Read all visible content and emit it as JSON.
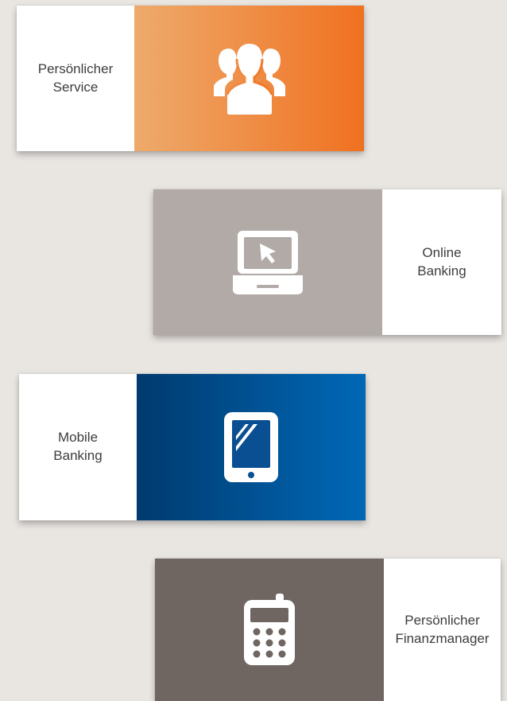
{
  "tiles": [
    {
      "id": "persoenlicher-service",
      "label_line1": "Persönlicher",
      "label_line2": "Service",
      "icon": "users-group-icon",
      "gradient_from": "#eeaa6c",
      "gradient_to": "#f07120"
    },
    {
      "id": "online-banking",
      "label_line1": "Online",
      "label_line2": "Banking",
      "icon": "laptop-cursor-icon",
      "color": "#b1aaa6"
    },
    {
      "id": "mobile-banking",
      "label_line1": "Mobile",
      "label_line2": "Banking",
      "icon": "tablet-icon",
      "gradient_from": "#003a6e",
      "gradient_to": "#0068b7"
    },
    {
      "id": "finanzmanager",
      "label_line1": "Persönlicher",
      "label_line2": "Finanzmanager",
      "icon": "calculator-icon",
      "color": "#6f6561"
    }
  ],
  "colors": {
    "background": "#e9e6e2",
    "label_text": "#3d3d3d",
    "label_background": "#ffffff"
  }
}
